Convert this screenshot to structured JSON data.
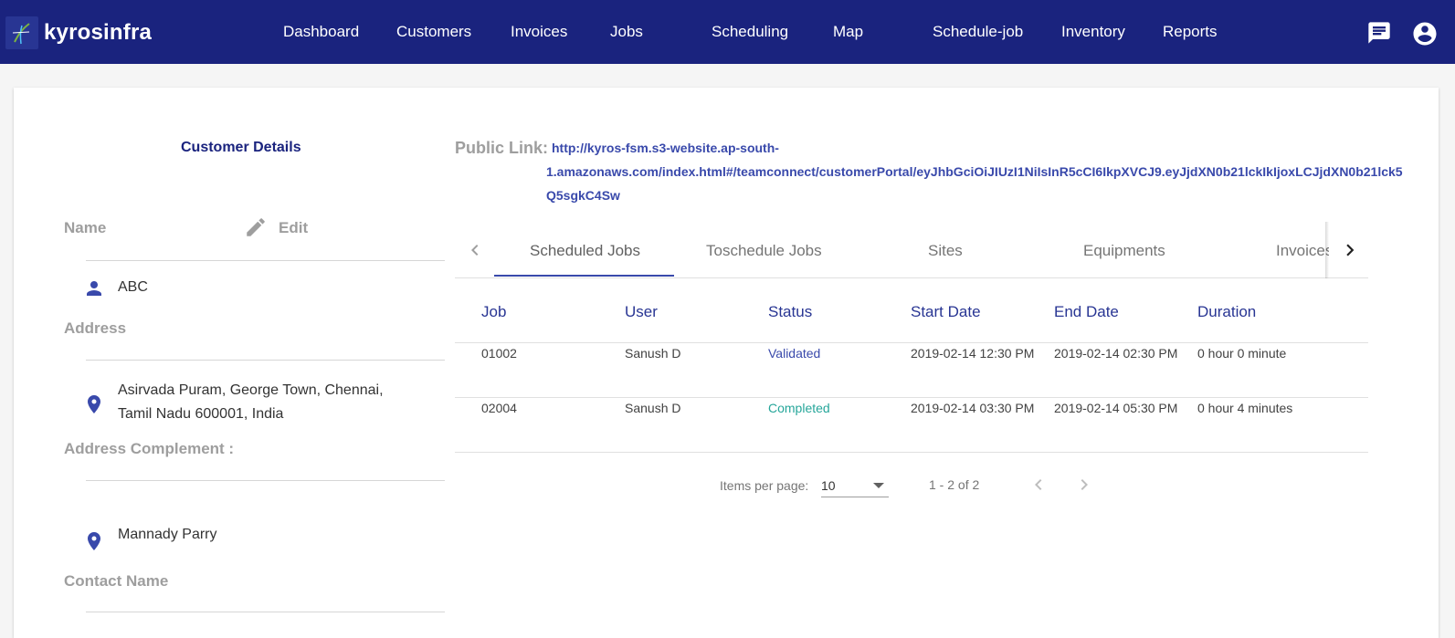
{
  "app": {
    "brand": "kyrosinfra",
    "colors": {
      "topbar": "#1a237e",
      "accent": "#3949ab",
      "completed": "#26a69a"
    }
  },
  "nav": {
    "items": [
      {
        "label": "Dashboard"
      },
      {
        "label": "Customers"
      },
      {
        "label": "Invoices"
      },
      {
        "label": "Jobs"
      },
      {
        "label": "Scheduling"
      },
      {
        "label": "Map"
      },
      {
        "label": "Schedule-job"
      },
      {
        "label": "Inventory"
      },
      {
        "label": "Reports"
      }
    ],
    "icons": [
      "chat-icon",
      "account-circle-icon"
    ]
  },
  "customer": {
    "section_title": "Customer Details",
    "name_label": "Name",
    "edit_label": "Edit",
    "name_value": "ABC",
    "address_label": "Address",
    "address_line1": "Asirvada Puram, George Town, Chennai,",
    "address_line2": "Tamil Nadu 600001, India",
    "address_complement_label": "Address Complement :",
    "address_complement_value": "Mannady Parry",
    "contact_name_label": "Contact Name"
  },
  "public_link": {
    "label": "Public Link:",
    "line1": "http://kyros-fsm.s3-website.ap-south-",
    "line2": "1.amazonaws.com/index.html#/teamconnect/customerPortal/eyJhbGciOiJIUzI1NiIsInR5cCI6IkpXVCJ9.eyJjdXN0b21lckIkIjoxLCJjdXN0b21lck5",
    "line3": "Q5sgkC4Sw"
  },
  "tabs": {
    "items": [
      {
        "label": "Scheduled Jobs",
        "active": true
      },
      {
        "label": "Toschedule Jobs",
        "active": false
      },
      {
        "label": "Sites",
        "active": false
      },
      {
        "label": "Equipments",
        "active": false
      },
      {
        "label": "Invoices",
        "active": false
      }
    ]
  },
  "table": {
    "columns": [
      "Job",
      "User",
      "Status",
      "Start Date",
      "End Date",
      "Duration"
    ],
    "rows": [
      {
        "job": "01002",
        "user": "Sanush D",
        "status": "Validated",
        "start": "2019-02-14 12:30 PM",
        "end": "2019-02-14 02:30 PM",
        "duration": "0 hour 0 minute"
      },
      {
        "job": "02004",
        "user": "Sanush D",
        "status": "Completed",
        "start": "2019-02-14 03:30 PM",
        "end": "2019-02-14 05:30 PM",
        "duration": "0 hour 4 minutes"
      }
    ]
  },
  "paginator": {
    "items_per_page_label": "Items per page:",
    "page_size": "10",
    "range": "1 - 2 of 2"
  }
}
